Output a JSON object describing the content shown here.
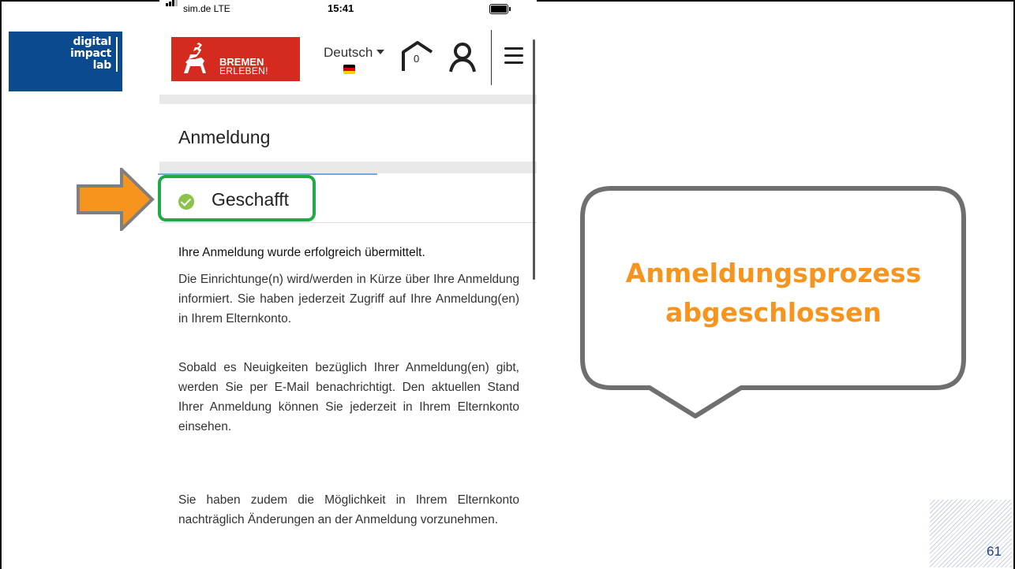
{
  "slide": {
    "logo_text": [
      "digital",
      "impact",
      "lab"
    ],
    "page_number": "61",
    "callout": [
      "Anmeldungsprozess",
      "abgeschlossen"
    ]
  },
  "status_bar": {
    "carrier": "sim.de  LTE",
    "time": "15:41"
  },
  "header": {
    "brand_line1": "BREMEN",
    "brand_line2": "ERLEBEN!",
    "language": "Deutsch",
    "cart_count": "0"
  },
  "page": {
    "title": "Anmeldung",
    "status_title": "Geschafft",
    "message_bold": "Ihre Anmeldung wurde erfolgreich übermittelt.",
    "paragraph1": "Die Einrichtunge(n) wird/werden in Kürze über Ihre Anmeldung informiert. Sie haben jederzeit Zugriff auf Ihre Anmeldung(en) in Ihrem Elternkonto.",
    "paragraph2": "Sobald es Neuigkeiten bezüglich Ihrer Anmeldung(en) gibt, werden Sie per E-Mail benachrichtigt. Den aktuellen Stand Ihrer Anmeldung können Sie jederzeit in Ihrem Elternkonto einsehen.",
    "paragraph3": "Sie haben zudem die Möglichkeit in Ihrem Elternkonto nachträglich Änderungen an der Anmeldung vorzunehmen."
  },
  "colors": {
    "brand_red": "#d52b1e",
    "success_green": "#8bc34a",
    "highlight_green": "#1eaa44",
    "callout_orange": "#f7941d",
    "logo_blue": "#0b4a8f"
  },
  "icons": [
    "signal-icon",
    "battery-icon",
    "home-icon",
    "user-icon",
    "hamburger-menu-icon",
    "check-icon",
    "arrow-icon"
  ]
}
